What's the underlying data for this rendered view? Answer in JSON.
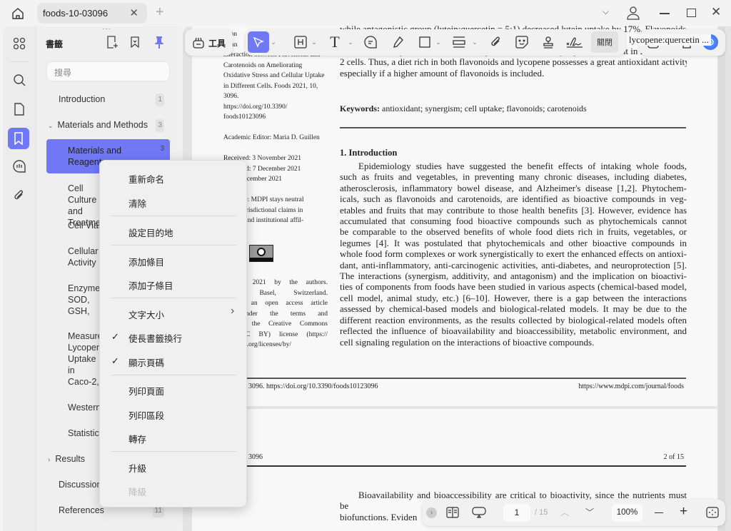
{
  "titlebar": {
    "tab_title": "foods-10-03096"
  },
  "sidebar": {
    "title": "書籤",
    "search_placeholder": "搜尋",
    "items": [
      {
        "label": "Introduction",
        "page": "1"
      },
      {
        "label": "Materials and Methods",
        "page": "3"
      },
      {
        "label": "Materials and Reagents",
        "page": "3"
      },
      {
        "label": "Cell Culture and Treatment"
      },
      {
        "label": "Cell Viability"
      },
      {
        "label": "Cellular Activity"
      },
      {
        "label": "Enzyme SOD, GSH, CAT"
      },
      {
        "label": "Measurement Lycopene Uptake in Caco-2, Cells"
      },
      {
        "label": "Western"
      },
      {
        "label": "Statistical"
      },
      {
        "label": "Results"
      },
      {
        "label": "Discussion"
      },
      {
        "label": "References",
        "page": "11"
      }
    ]
  },
  "toolbar": {
    "tools_label": "工具",
    "close_label": "關閉",
    "accent": "#7078f6"
  },
  "context_menu": {
    "items": [
      "重新命名",
      "清除",
      "設定目的地",
      "添加條目",
      "添加子條目",
      "文字大小",
      "使長書籤換行",
      "顯示頁碼",
      "列印頁面",
      "列印區段",
      "轉存",
      "升級",
      "降級"
    ],
    "checked": [
      "使長書籤換行",
      "顯示頁碼"
    ],
    "disabled": [
      "降級"
    ]
  },
  "document": {
    "left_col": [
      "ation",
      "Zhan",
      "interaction between Flavonoids and",
      "Carotenoids on Ameliorating",
      "Oxidative Stress and Cellular Uptake",
      "in Different Cells. Foods 2021, 10, 3096.",
      "https://doi.org/10.3390/",
      "foods10123096",
      "",
      "Academic Editor: Maria D. Guillen",
      "",
      "Received: 3 November 2021",
      "Accepted: 7 December 2021",
      "d: 14 December 2021",
      "",
      "er's Note: MDPI stays neutral",
      "ard to jurisdictional claims in",
      "d maps and institutional affil-"
    ],
    "left_col2": [
      "ht: © 2021 by the authors.",
      "MDPI, Basel, Switzerland.",
      "cle is an open access article",
      "ed under the terms and",
      "ns of the Creative Commons",
      "on (CC BY) license (https://",
      "ommons.org/licenses/by/"
    ],
    "abstract_end": [
      "while antagonistic group (lutein:quercetin = 5:1) decreased lutein uptake by 17%. Flavonoids modu-",
      "lycopene:quercetin ...",
      "increased the expression of SR-BI compared to individual lycopene treatment in HUVEC and Caco-",
      "2 cells.  Thus, a diet rich in both flavonoids and lycopene possesses a great antioxidant activity,",
      "especially if a higher amount of flavonoids is included."
    ],
    "keywords_label": "Keywords:",
    "keywords": "antioxidant; synergism; cell uptake; flavonoids; carotenoids",
    "section_title": "1. Introduction",
    "intro": [
      "Epidemiology studies have suggested the benefit effects of intaking whole foods,",
      "such as fruits and vegetables, in preventing many chronic diseases, including diabetes,",
      "atherosclerosis, inflammatory bowel disease, and Alzheimer's disease [1,2]. Phytochem-",
      "icals, such as flavonoids and carotenoids, are identified as bioactive compounds in veg-",
      "etables and fruits that may contribute to those health benefits [3]. However, evidence has",
      "accumulated that consuming food bioactive compounds such as phytochemicals cannot",
      "be comparable to the observed benefits of whole food diets rich in fruits, vegetables, or",
      "legumes [4].  It was postulated that phytochemicals and other bioactive compounds in",
      "whole food form complexes or work synergistically to exert the enhanced effects on antioxi-",
      "dant, anti-inflammatory, anti-carcinogenic activities, anti-diabetes, and neuroprotection [5].",
      "The interactions (synergism, additivity, and antagonism) and the implication on bioactivi-",
      "ties of components from foods have been studied in various aspects (chemical-based model,",
      "cell model, animal study, etc.) [6–10]. However, there is a gap between the interactions",
      "assessed by chemical-based models and biological-related models. It may be due to the",
      "different reaction environments, as the results collected by biological-related models often",
      "reflected the influence of bioavailability and bioaccessibility, metabolic environment, and",
      "cell signaling regulation on the interactions of bioactive compounds."
    ],
    "footer_left": "021, 10, 3096. https://doi.org/10.3390/foods10123096",
    "footer_right": "https://www.mdpi.com/journal/foods",
    "header2_left": "021, 10, 3096",
    "header2_right": "2 of 15",
    "page2": [
      "Bioavailability and bioaccessibility are critical to bioactivity, since the nutrients must",
      "be absorbed, distribu",
      "biofunctions. Eviden"
    ]
  },
  "bottombar": {
    "page": "1",
    "total": "/ 15",
    "zoom": "100%"
  }
}
